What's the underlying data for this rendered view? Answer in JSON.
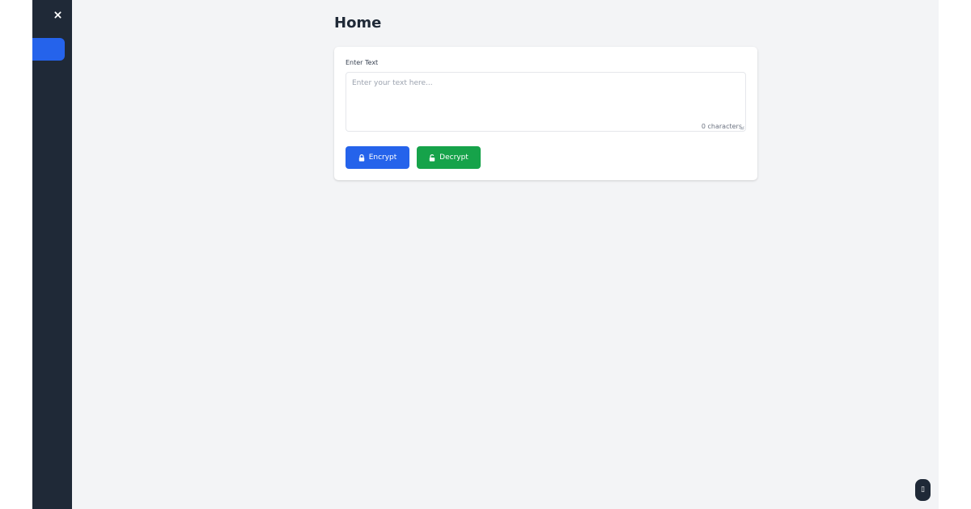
{
  "sidebar": {
    "close_icon": "close-icon",
    "items": [
      {
        "label": "",
        "active": true
      }
    ],
    "colors": {
      "background": "#1f2937",
      "active": "#2563eb"
    }
  },
  "page": {
    "title": "Home"
  },
  "form": {
    "label": "Enter Text",
    "input_value": "",
    "placeholder": "Enter your text here...",
    "char_count": "0 characters"
  },
  "actions": {
    "encrypt": {
      "label": "Encrypt",
      "icon": "lock-icon",
      "color": "#2563eb"
    },
    "decrypt": {
      "label": "Decrypt",
      "icon": "unlock-icon",
      "color": "#16a34a"
    }
  },
  "floating_button": {
    "icon": "phone-icon",
    "glyph": "▯"
  },
  "theme": {
    "page_background": "#f3f4f6",
    "card_background": "#ffffff",
    "text_dark": "#1f2937"
  }
}
